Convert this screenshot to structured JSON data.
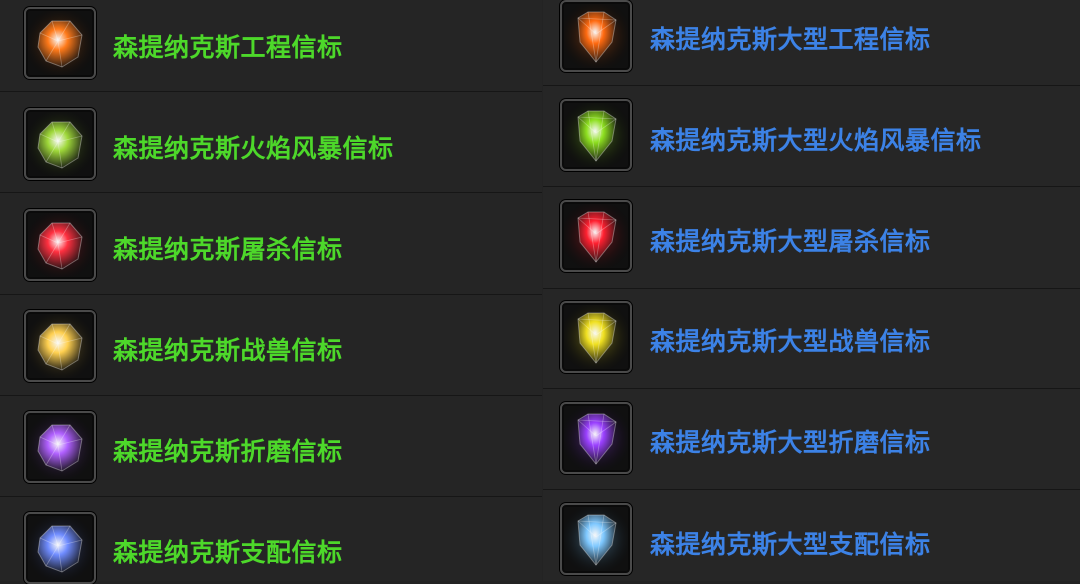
{
  "left_items": [
    {
      "name": "森提纳克斯工程信标",
      "icon": "orange-gem-icon",
      "color": "#ff7a1a"
    },
    {
      "name": "森提纳克斯火焰风暴信标",
      "icon": "green-gem-icon",
      "color": "#9fd83a"
    },
    {
      "name": "森提纳克斯屠杀信标",
      "icon": "red-gem-icon",
      "color": "#ff3040"
    },
    {
      "name": "森提纳克斯战兽信标",
      "icon": "yellow-gem-icon",
      "color": "#ffd050"
    },
    {
      "name": "森提纳克斯折磨信标",
      "icon": "purple-gem-icon",
      "color": "#b060ff"
    },
    {
      "name": "森提纳克斯支配信标",
      "icon": "blue-gem-icon",
      "color": "#6f8cff"
    }
  ],
  "right_items": [
    {
      "name": "森提纳克斯大型工程信标",
      "icon": "large-orange-gem-icon",
      "color": "#ff6a10"
    },
    {
      "name": "森提纳克斯大型火焰风暴信标",
      "icon": "large-green-gem-icon",
      "color": "#8ee020"
    },
    {
      "name": "森提纳克斯大型屠杀信标",
      "icon": "large-red-gem-icon",
      "color": "#ff2030"
    },
    {
      "name": "森提纳克斯大型战兽信标",
      "icon": "large-yellow-gem-icon",
      "color": "#f0e020"
    },
    {
      "name": "森提纳克斯大型折磨信标",
      "icon": "large-purple-gem-icon",
      "color": "#9a40ff"
    },
    {
      "name": "森提纳克斯大型支配信标",
      "icon": "large-blue-gem-icon",
      "color": "#7ec8ff"
    }
  ]
}
